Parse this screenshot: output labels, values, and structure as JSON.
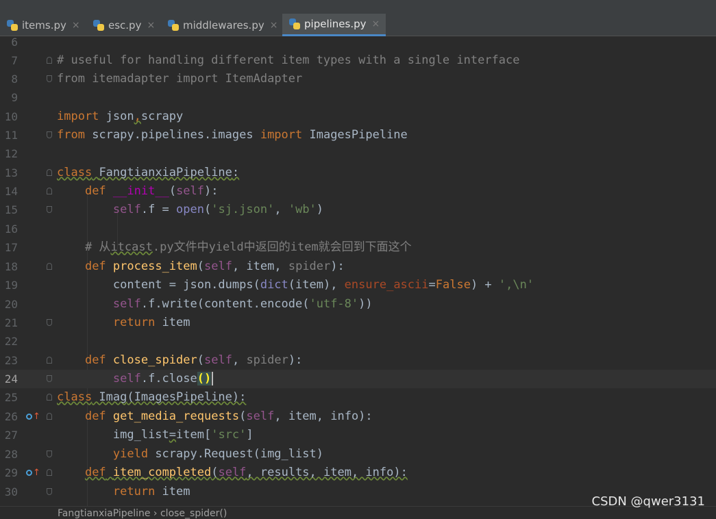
{
  "tabs": [
    {
      "label": "items.py",
      "close": "×",
      "active": false
    },
    {
      "label": "esc.py",
      "close": "×",
      "active": false
    },
    {
      "label": "middlewares.py",
      "close": "×",
      "active": false
    },
    {
      "label": "pipelines.py",
      "close": "×",
      "active": true
    }
  ],
  "editor": {
    "current_line": 24,
    "line_numbers": [
      "6",
      "7",
      "8",
      "9",
      "10",
      "11",
      "12",
      "13",
      "14",
      "15",
      "16",
      "17",
      "18",
      "19",
      "20",
      "21",
      "22",
      "23",
      "24",
      "25",
      "26",
      "27",
      "28",
      "29",
      "30"
    ],
    "l7": "# useful for handling different item types with a single interface",
    "l8": {
      "from": "from",
      "module": " itemadapter ",
      "import": "import",
      "name": " ItemAdapter"
    },
    "l10": {
      "import": "import",
      "a": " json",
      "comma": ",",
      "b": "scrapy"
    },
    "l11": {
      "from": "from",
      "module": " scrapy.pipelines.images ",
      "import": "import",
      "name": " ImagesPipeline"
    },
    "l13": {
      "class": "class",
      "name": "FangtianxiaPipeline",
      "colon": ":"
    },
    "l14": {
      "def": "def",
      "fn": "__init__",
      "open": "(",
      "self": "self",
      "close": "):"
    },
    "l15": {
      "self": "self",
      "a": ".f = ",
      "open_fn": "open",
      "b": "(",
      "s1": "'sj.json'",
      "c": ", ",
      "s2": "'wb'",
      "d": ")"
    },
    "l17": {
      "a": "# 从",
      "b": "itcast",
      "c": ".py文件中yield中返回的item就会回到下面这个"
    },
    "l18": {
      "def": "def",
      "fn": "process_item",
      "a": "(",
      "self": "self",
      "b": ", item, ",
      "spider": "spider",
      "c": "):"
    },
    "l19": {
      "a": "content = json.dumps(",
      "dict": "dict",
      "b": "(item), ",
      "kw": "ensure_ascii",
      "c": "=",
      "false": "False",
      "d": ") + ",
      "s": "',\\n'"
    },
    "l20": {
      "self": "self",
      "a": ".f.write(content.encode(",
      "s": "'utf-8'",
      "b": "))"
    },
    "l21": {
      "return": "return",
      "a": " item"
    },
    "l23": {
      "def": "def",
      "fn": "close_spider",
      "a": "(",
      "self": "self",
      "b": ", ",
      "spider": "spider",
      "c": "):"
    },
    "l24": {
      "self": "self",
      "a": ".f.close",
      "paren": "()"
    },
    "l25": {
      "class": "class",
      "name": " Imag",
      "a": "(ImagesPipeline):"
    },
    "l26": {
      "def": "def",
      "fn": "get_media_requests",
      "a": "(",
      "self": "self",
      "b": ", item, info):"
    },
    "l27": {
      "a": "img_list",
      "eq": "=",
      "b": "item[",
      "s": "'src'",
      "c": "]"
    },
    "l28": {
      "yield": "yield",
      "a": " scrapy.Request(img_list)"
    },
    "l29": {
      "def": "def",
      "fn": "item_completed",
      "a": "(",
      "self": "self",
      "b": ", results, item, info):"
    },
    "l30": {
      "return": "return",
      "a": " item"
    }
  },
  "breadcrumb": {
    "cls": "FangtianxiaPipeline",
    "sep": " › ",
    "method": "close_spider()"
  },
  "watermark": "CSDN @qwer3131",
  "colors": {
    "keyword": "#cc7832",
    "string": "#6a8759",
    "function": "#ffc66d",
    "self": "#94558d",
    "magic": "#b200b2",
    "comment": "#808080",
    "text": "#a9b7c6",
    "tab_accent": "#4a88c7"
  }
}
